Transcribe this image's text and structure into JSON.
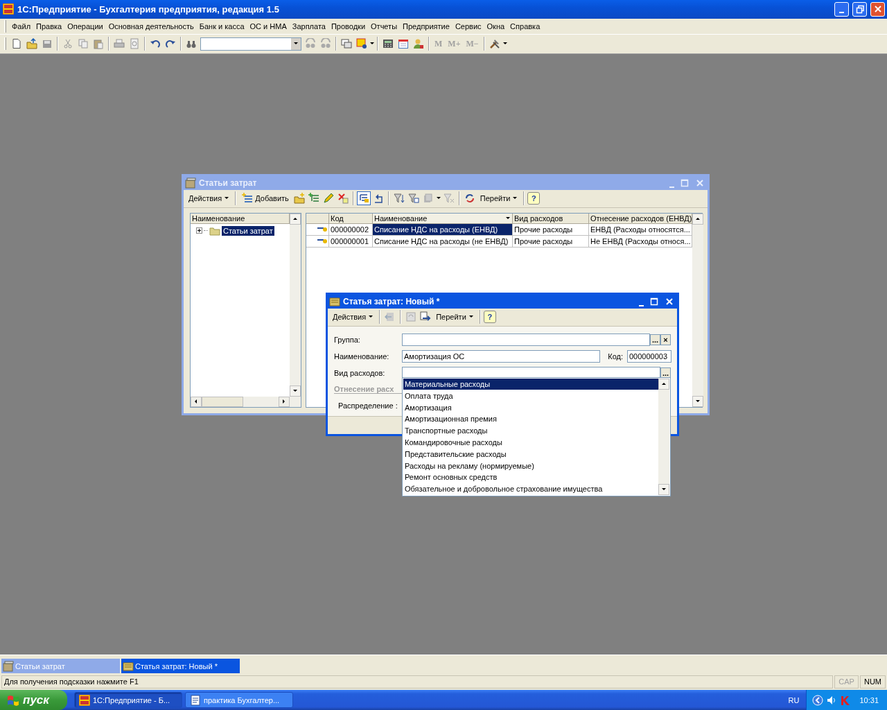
{
  "app_window": {
    "title": "1С:Предприятие - Бухгалтерия предприятия, редакция 1.5"
  },
  "menu": [
    "Файл",
    "Правка",
    "Операции",
    "Основная деятельность",
    "Банк и касса",
    "ОС и НМА",
    "Зарплата",
    "Проводки",
    "Отчеты",
    "Предприятие",
    "Сервис",
    "Окна",
    "Справка"
  ],
  "toolbar": {
    "memory_buttons": [
      "M",
      "M+",
      "M−"
    ]
  },
  "list_window": {
    "title": "Статьи затрат",
    "active": false,
    "toolbar": {
      "actions": "Действия",
      "add": "Добавить",
      "goto": "Перейти",
      "help": "?"
    },
    "tree": {
      "header": "Наименование",
      "items": [
        {
          "label": "Статьи затрат",
          "selected": true,
          "expanded": false
        }
      ]
    },
    "table": {
      "columns": [
        {
          "label": "Код",
          "sorted": false
        },
        {
          "label": "Наименование",
          "sorted": true
        },
        {
          "label": "Вид расходов",
          "sorted": false
        },
        {
          "label": "Отнесение расходов (ЕНВД)",
          "sorted": false
        }
      ],
      "rows": [
        {
          "cells": [
            "000000002",
            "Списание НДС на расходы (ЕНВД)",
            "Прочие расходы",
            "ЕНВД (Расходы относятся..."
          ],
          "selected": true
        },
        {
          "cells": [
            "000000001",
            "Списание НДС на расходы (не ЕНВД)",
            "Прочие расходы",
            "Не ЕНВД (Расходы относя..."
          ],
          "selected": false
        }
      ]
    }
  },
  "form_window": {
    "title": "Статья затрат: Новый *",
    "active": true,
    "toolbar": {
      "actions": "Действия",
      "goto": "Перейти",
      "help": "?"
    },
    "group_label": "Группа:",
    "group_choose": "...",
    "group_clear": "×",
    "name_label": "Наименование:",
    "name_value": "Амортизация ОС",
    "code_label": "Код:",
    "code_value": "000000003",
    "expense_type_label": "Вид расходов:",
    "expense_type_choose": "...",
    "section_title": "Отнесение расх",
    "distribution_label": "Распределение :"
  },
  "dropdown": {
    "items": [
      {
        "label": "Материальные расходы",
        "selected": true
      },
      {
        "label": "Оплата труда",
        "selected": false
      },
      {
        "label": "Амортизация",
        "selected": false
      },
      {
        "label": "Амортизационная премия",
        "selected": false
      },
      {
        "label": "Транспортные расходы",
        "selected": false
      },
      {
        "label": "Командировочные расходы",
        "selected": false
      },
      {
        "label": "Представительские расходы",
        "selected": false
      },
      {
        "label": "Расходы на рекламу (нормируемые)",
        "selected": false
      },
      {
        "label": "Ремонт основных средств",
        "selected": false
      },
      {
        "label": "Обязательное и добровольное страхование имущества",
        "selected": false
      }
    ]
  },
  "window_tabs": [
    {
      "label": "Статьи затрат",
      "selected": false
    },
    {
      "label": "Статья затрат: Новый *",
      "selected": true
    }
  ],
  "status_bar": {
    "hint": "Для получения подсказки нажмите F1",
    "indicators": [
      {
        "label": "CAP",
        "on": false
      },
      {
        "label": "NUM",
        "on": true
      }
    ]
  },
  "taskbar": {
    "start": "пуск",
    "tasks": [
      {
        "label": "1С:Предприятие - Б...",
        "selected": true
      },
      {
        "label": "практика Бухгалтер...",
        "selected": false
      }
    ],
    "language": "RU",
    "clock": "10:31"
  }
}
